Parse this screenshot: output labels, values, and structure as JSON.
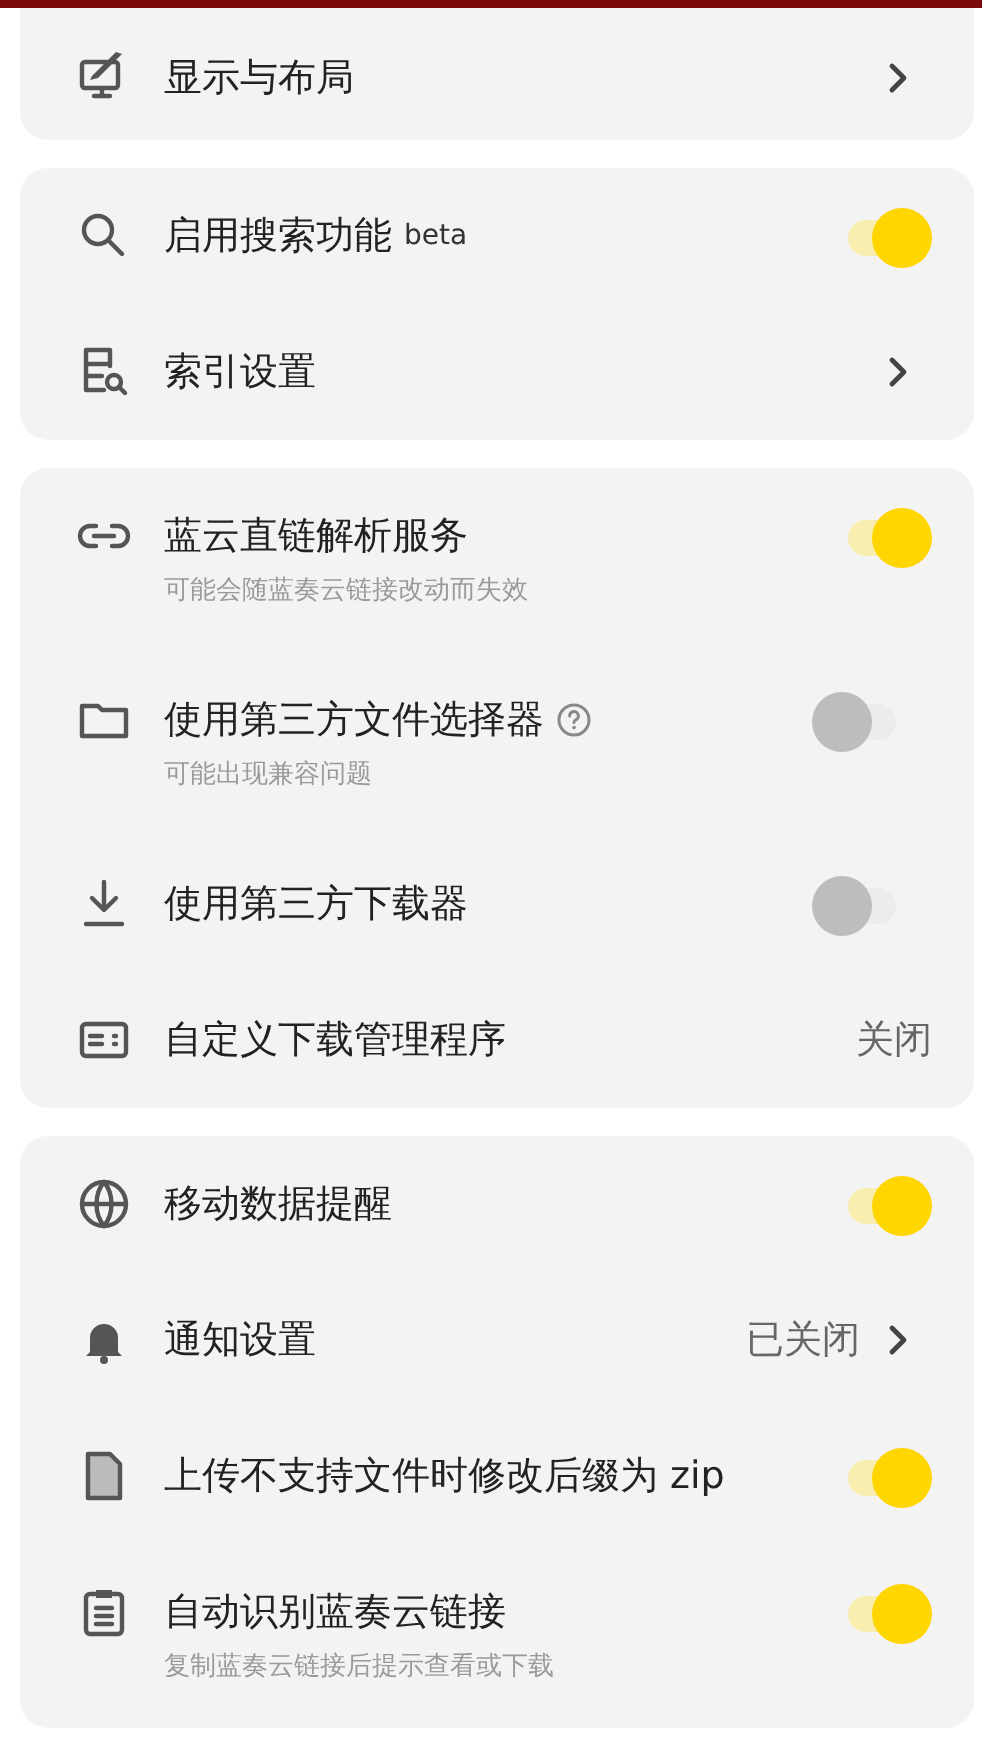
{
  "groups": [
    {
      "items": [
        {
          "kind": "link",
          "title": "显示与布局"
        }
      ]
    },
    {
      "items": [
        {
          "kind": "toggle",
          "title": "启用搜索功能",
          "tag": "beta",
          "on": true
        },
        {
          "kind": "link",
          "title": "索引设置"
        }
      ]
    },
    {
      "items": [
        {
          "kind": "toggle",
          "title": "蓝云直链解析服务",
          "subtitle": "可能会随蓝奏云链接改动而失效",
          "on": true
        },
        {
          "kind": "toggle",
          "title": "使用第三方文件选择器",
          "help": true,
          "subtitle": "可能出现兼容问题",
          "on": false
        },
        {
          "kind": "toggle",
          "title": "使用第三方下载器",
          "on": false
        },
        {
          "kind": "value",
          "title": "自定义下载管理程序",
          "value": "关闭"
        }
      ]
    },
    {
      "items": [
        {
          "kind": "toggle",
          "title": "移动数据提醒",
          "on": true
        },
        {
          "kind": "link",
          "title": "通知设置",
          "value": "已关闭"
        },
        {
          "kind": "toggle",
          "title": "上传不支持文件时修改后缀为 zip",
          "on": true
        },
        {
          "kind": "toggle",
          "title": "自动识别蓝奏云链接",
          "subtitle": "复制蓝奏云链接后提示查看或下载",
          "on": true
        }
      ]
    }
  ]
}
